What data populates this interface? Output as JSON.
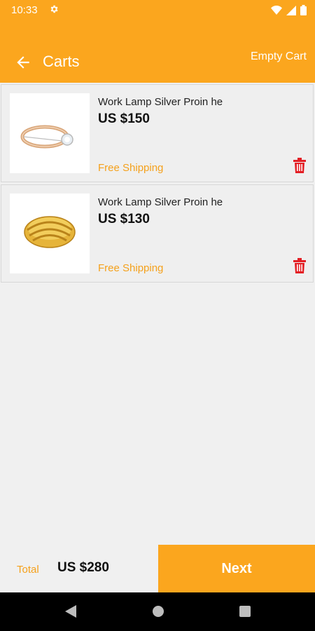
{
  "status": {
    "time": "10:33"
  },
  "header": {
    "title": "Carts",
    "empty_label": "Empty Cart"
  },
  "cart": {
    "items": [
      {
        "name": "Work Lamp Silver Proin he",
        "price": "US $150",
        "shipping": "Free Shipping"
      },
      {
        "name": "Work Lamp Silver Proin he",
        "price": "US $130",
        "shipping": "Free Shipping"
      }
    ]
  },
  "footer": {
    "total_label": "Total",
    "total_value": "US $280",
    "next_label": "Next"
  },
  "colors": {
    "accent": "#fba61e",
    "shipping_text": "#f5a11c",
    "delete": "#e31e24"
  }
}
